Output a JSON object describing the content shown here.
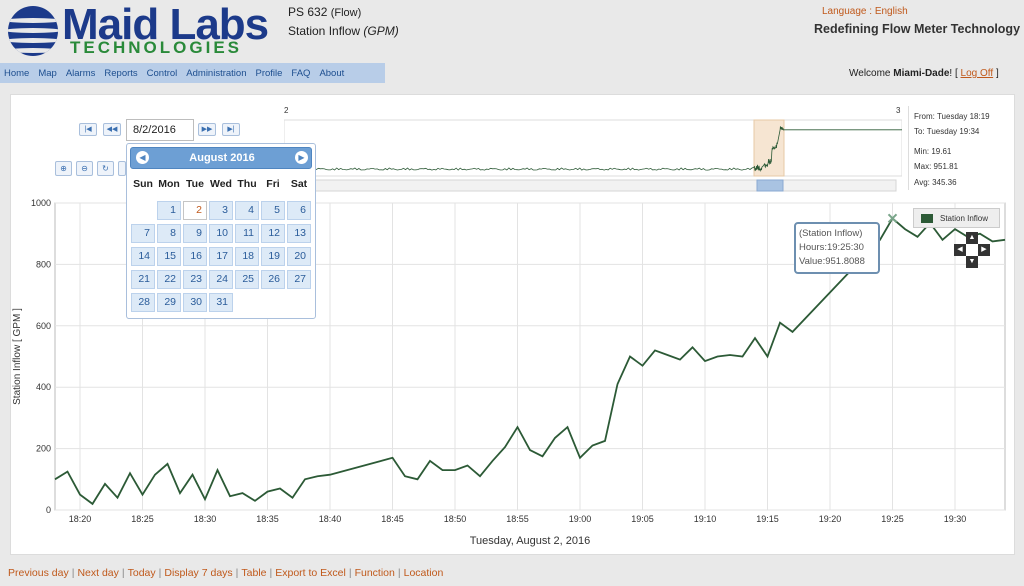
{
  "header": {
    "logo_name": "Maid Labs",
    "logo_sub": "TECHNOLOGIES",
    "station_title": "PS 632",
    "station_type": "(Flow)",
    "metric": "Station Inflow",
    "metric_unit": "(GPM)",
    "language": "Language : English",
    "tagline": "Redefining Flow Meter Technology"
  },
  "nav": {
    "items": [
      "Home",
      "Map",
      "Alarms",
      "Reports",
      "Control",
      "Administration",
      "Profile",
      "FAQ",
      "About"
    ],
    "welcome_prefix": "Welcome",
    "user": "Miami-Dade",
    "welcome_suffix": "! [",
    "logoff": "Log Off",
    "close_bracket": "]"
  },
  "datepicker": {
    "value": "8/2/2016",
    "month_title": "August  2016",
    "weekdays": [
      "Sun",
      "Mon",
      "Tue",
      "Wed",
      "Thu",
      "Fri",
      "Sat"
    ],
    "first_weekday_index": 1,
    "days_in_month": 31,
    "selected_day": 2
  },
  "overview": {
    "left_marker": "2",
    "right_marker": "3",
    "from": "From: Tuesday 18:19",
    "to": "To: Tuesday 19:34",
    "min": "Min: 19.61",
    "max": "Max: 951.81",
    "avg": "Avg: 345.36"
  },
  "legend": {
    "label": "Station Inflow",
    "color": "#2c5a36"
  },
  "tooltip": {
    "series": "(Station Inflow)",
    "hours": "Hours:19:25:30",
    "value": "Value:951.8088"
  },
  "chart_data": {
    "type": "line",
    "ylabel": "Station Inflow [ GPM ]",
    "xlabel": "Tuesday, August 2, 2016",
    "ylim": [
      0,
      1000
    ],
    "yticks": [
      "0",
      "200",
      "400",
      "600",
      "800",
      "1000"
    ],
    "xticks": [
      "18:20",
      "18:25",
      "18:30",
      "18:35",
      "18:40",
      "18:45",
      "18:50",
      "18:55",
      "19:00",
      "19:05",
      "19:10",
      "19:15",
      "19:20",
      "19:25",
      "19:30"
    ],
    "x_minutes_range": [
      "18:18",
      "19:34"
    ],
    "grid": true,
    "series": [
      {
        "name": "Station Inflow",
        "color": "#2c5a36",
        "x": [
          "18:18",
          "18:19",
          "18:20",
          "18:21",
          "18:22",
          "18:23",
          "18:24",
          "18:25",
          "18:26",
          "18:27",
          "18:28",
          "18:29",
          "18:30",
          "18:31",
          "18:32",
          "18:33",
          "18:34",
          "18:35",
          "18:36",
          "18:37",
          "18:38",
          "18:39",
          "18:40",
          "18:45",
          "18:46",
          "18:47",
          "18:48",
          "18:49",
          "18:50",
          "18:51",
          "18:52",
          "18:53",
          "18:54",
          "18:55",
          "18:56",
          "18:57",
          "18:58",
          "18:59",
          "19:00",
          "19:01",
          "19:02",
          "19:03",
          "19:04",
          "19:05",
          "19:06",
          "19:07",
          "19:08",
          "19:09",
          "19:10",
          "19:11",
          "19:12",
          "19:13",
          "19:14",
          "19:15",
          "19:16",
          "19:17",
          "19:24",
          "19:25",
          "19:26",
          "19:27",
          "19:28",
          "19:29",
          "19:30",
          "19:31",
          "19:32",
          "19:33",
          "19:34"
        ],
        "values": [
          100,
          125,
          50,
          20,
          85,
          40,
          120,
          50,
          115,
          150,
          55,
          115,
          35,
          130,
          45,
          55,
          30,
          60,
          70,
          40,
          100,
          110,
          115,
          170,
          110,
          100,
          160,
          130,
          130,
          145,
          110,
          160,
          205,
          270,
          195,
          175,
          235,
          270,
          170,
          210,
          225,
          410,
          500,
          470,
          520,
          505,
          490,
          530,
          485,
          500,
          505,
          500,
          560,
          500,
          610,
          580,
          880,
          950,
          915,
          890,
          935,
          880,
          915,
          890,
          900,
          875,
          880
        ]
      }
    ]
  }
}
